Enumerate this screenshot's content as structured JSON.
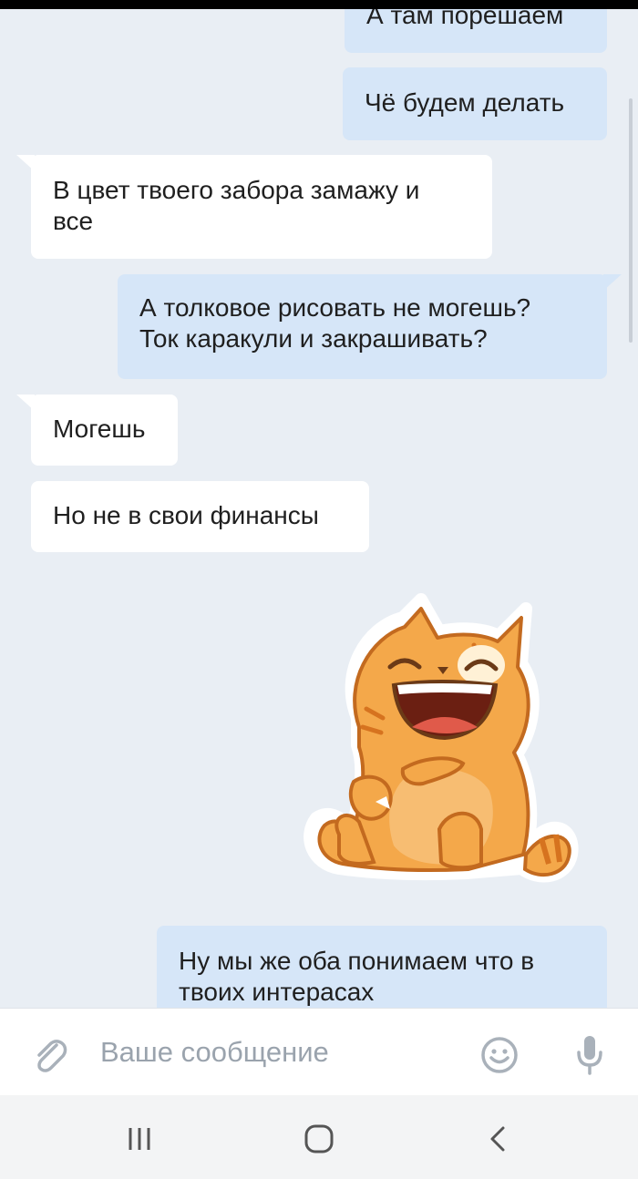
{
  "messages": [
    {
      "direction": "out",
      "text": "А там порешаем"
    },
    {
      "direction": "out",
      "text": "Чё будем делать"
    },
    {
      "direction": "in",
      "lines": [
        "В цвет твоего забора замажу и",
        "все"
      ]
    },
    {
      "direction": "out",
      "lines": [
        "А толковое рисовать не могешь?",
        "Ток каракули и закрашивать?"
      ]
    },
    {
      "direction": "in",
      "text": "Могешь"
    },
    {
      "direction": "in",
      "text": "Но не в свои финансы"
    },
    {
      "direction": "out",
      "type": "sticker",
      "sticker": "laughing-orange-cat"
    },
    {
      "direction": "out",
      "lines": [
        "Ну мы же оба понимаем что в",
        "твоих интерасах"
      ]
    }
  ],
  "composer": {
    "placeholder": "Ваше сообщение",
    "icons": [
      "paperclip-icon",
      "emoji-icon",
      "microphone-icon"
    ]
  },
  "navbar": {
    "icons": [
      "recent-apps-icon",
      "home-icon",
      "back-icon"
    ]
  },
  "colors": {
    "background": "#e9eef4",
    "outgoing_bubble": "#d6e6f8",
    "incoming_bubble": "#ffffff",
    "icon_gray": "#a9b1ba",
    "cat_orange": "#f4a84a"
  }
}
